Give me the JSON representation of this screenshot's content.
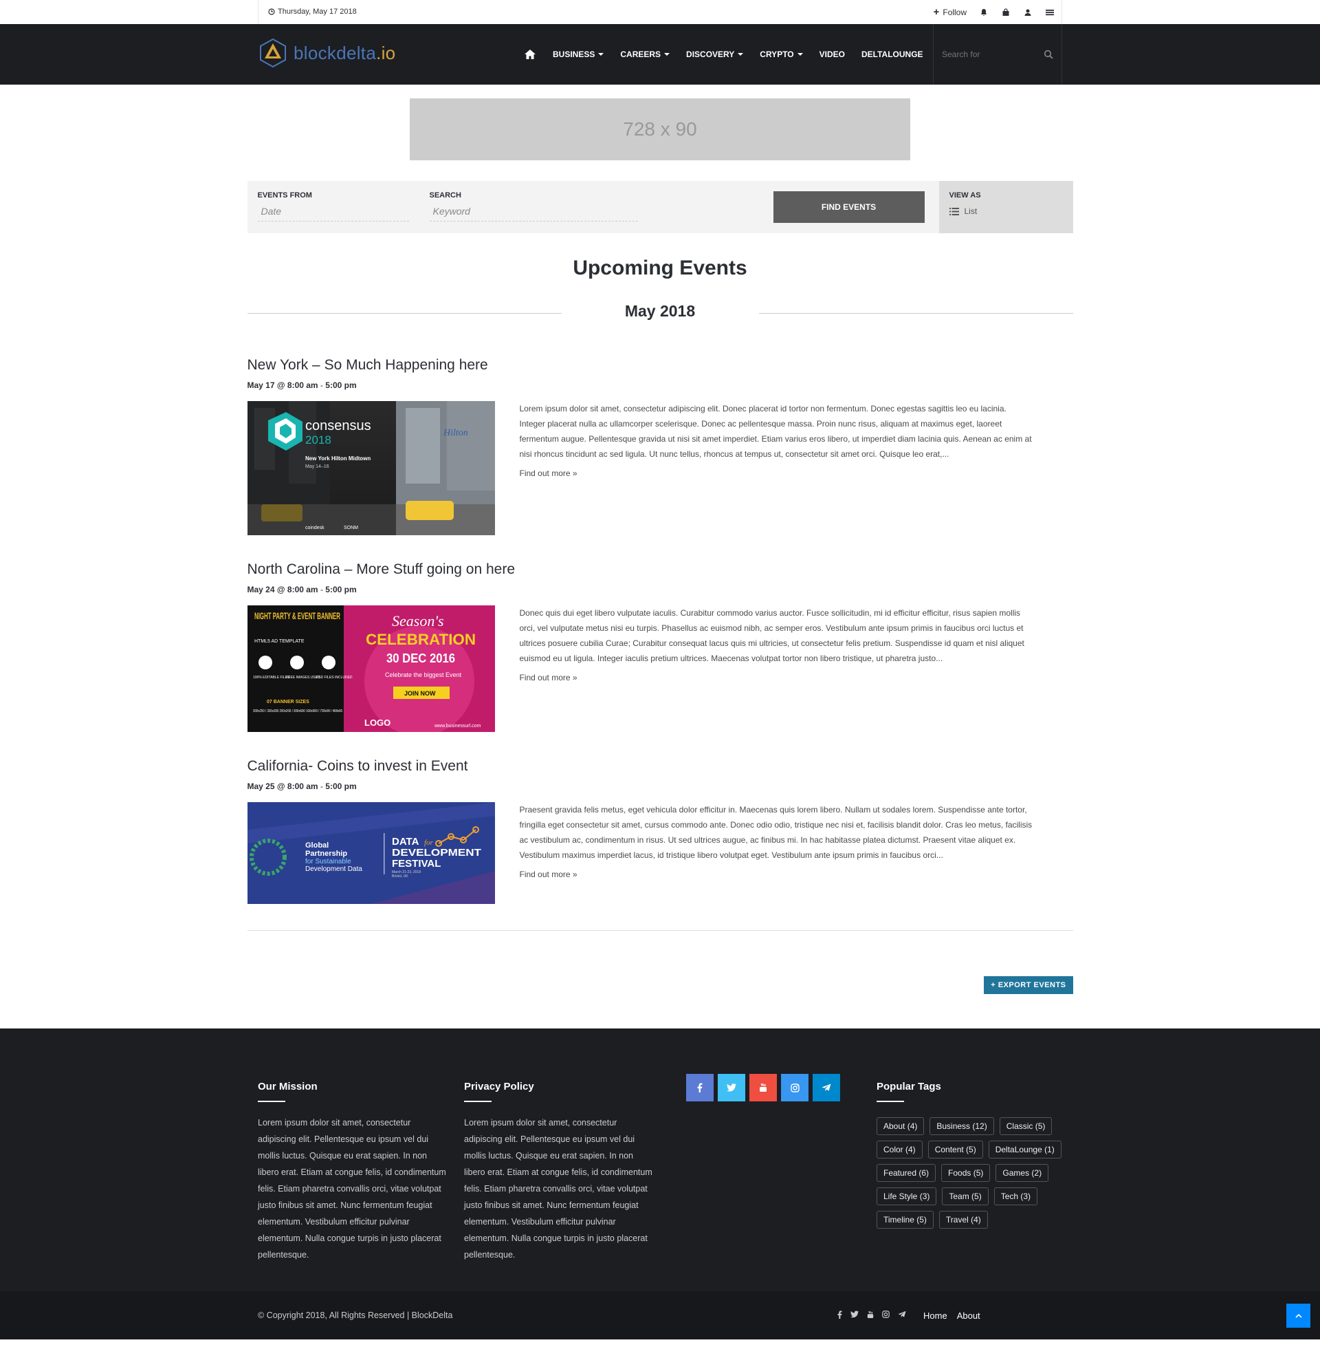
{
  "topbar": {
    "date": "Thursday, May 17 2018",
    "follow": "Follow"
  },
  "logo": {
    "name_main": "blockdelta",
    "name_tld": ".io"
  },
  "nav": {
    "items": [
      {
        "label": "BUSINESS",
        "dropdown": true
      },
      {
        "label": "CAREERS",
        "dropdown": true
      },
      {
        "label": "DISCOVERY",
        "dropdown": true
      },
      {
        "label": "CRYPTO",
        "dropdown": true
      },
      {
        "label": "VIDEO",
        "dropdown": false
      },
      {
        "label": "DELTALOUNGE",
        "dropdown": false
      }
    ],
    "search_placeholder": "Search for"
  },
  "ad": {
    "text": "728 x 90"
  },
  "event_bar": {
    "events_from_label": "EVENTS FROM",
    "events_from_placeholder": "Date",
    "search_label": "SEARCH",
    "search_placeholder": "Keyword",
    "find_button": "FIND EVENTS",
    "view_as_label": "VIEW AS",
    "view_as_value": "List"
  },
  "page_title": "Upcoming Events",
  "month": "May 2018",
  "events": [
    {
      "title": "New York – So Much Happening here",
      "date": "May 17 @ 8:00 am",
      "sep": "-",
      "end": "5:00 pm",
      "description": "Lorem ipsum dolor sit amet, consectetur adipiscing elit. Donec placerat id tortor non fermentum. Donec egestas sagittis leo eu lacinia. Integer placerat nulla ac ullamcorper scelerisque. Donec ac pellentesque massa. Proin nunc risus, aliquam at maximus eget, laoreet fermentum augue. Pellentesque gravida ut nisi sit amet imperdiet. Etiam varius eros libero, ut imperdiet diam lacinia quis. Aenean ac enim at nisi rhoncus tincidunt ac sed ligula. Ut nunc tellus, rhoncus at tempus ut, consectetur sit amet orci. Quisque leo erat,...",
      "more": "Find out more »",
      "image": {
        "brand": "consensus",
        "year": "2018",
        "venue": "New York Hilton Midtown",
        "dates": "May 14–16",
        "sponsor1": "coindesk",
        "sponsor2": "SONM",
        "sign": "Hilton"
      }
    },
    {
      "title": "North Carolina – More Stuff going on here",
      "date": "May 24 @ 8:00 am",
      "sep": "-",
      "end": "5:00 pm",
      "description": "Donec quis dui eget libero vulputate iaculis. Curabitur commodo varius auctor. Fusce sollicitudin, mi id efficitur efficitur, risus sapien mollis orci, vel vulputate metus nisi eu turpis. Phasellus ac euismod nibh, ac semper eros. Vestibulum ante ipsum primis in faucibus orci luctus et ultrices posuere cubilia Curae; Curabitur consequat lacus quis mi ultricies, ut consectetur felis pretium. Suspendisse id quam et nisl aliquet euismod eu ut ligula. Integer iaculis pretium ultrices. Maecenas volutpat tortor non libero tristique, ut pharetra justo...",
      "more": "Find out more »",
      "image": {
        "left_title": "NIGHT PARTY & EVENT BANNER",
        "left_sub": "HTML5 AD TEMPLATE",
        "f1": "100% EDITABLE FILES",
        "f2": "FREE IMAGES USED",
        "f3": "PSD FILES INCLUDED",
        "sizes_title": "07 BANNER SIZES",
        "sizes": "300x250 / 336x280 200x200 / 300x600 160x600 / 728x90 / 468x60",
        "script": "Season's",
        "headline": "CELEBRATION",
        "date": "30 DEC 2016",
        "tagline": "Celebrate the biggest Event",
        "cta": "JOIN NOW",
        "logo": "LOGO",
        "url": "www.businessurl.com"
      }
    },
    {
      "title": "California- Coins to invest in Event",
      "date": "May 25 @ 8:00 am",
      "sep": "-",
      "end": "5:00 pm",
      "description": "Praesent gravida felis metus, eget vehicula dolor efficitur in. Maecenas quis lorem libero. Nullam ut sodales lorem. Suspendisse ante tortor, fringilla eget consectetur sit amet, cursus commodo ante. Donec odio odio, tristique nec nisi et, facilisis blandit dolor. Cras leo metus, facilisis ac vestibulum ac, condimentum in risus. Ut sed ultrices augue, ac finibus mi. In hac habitasse platea dictumst. Praesent vitae aliquet ex. Vestibulum maximus imperdiet lacus, id tristique libero volutpat eget. Vestibulum ante ipsum primis in faucibus orci...",
      "more": "Find out more »",
      "image": {
        "org1": "Global",
        "org2": "Partnership",
        "org3": "for Sustainable",
        "org4": "Development Data",
        "fest1": "DATA",
        "fest_for": "for",
        "fest2": "DEVELOPMENT",
        "fest3": "FESTIVAL",
        "fest_date": "March 21-23, 2018",
        "fest_place": "Bristol, UK"
      }
    }
  ],
  "export_button": "+ EXPORT EVENTS",
  "footer": {
    "mission_title": "Our Mission",
    "mission_text": "Lorem ipsum dolor sit amet, consectetur adipiscing elit. Pellentesque eu ipsum vel dui mollis luctus. Quisque eu erat sapien. In non libero erat. Etiam at congue felis, id condimentum felis. Etiam pharetra convallis orci, vitae volutpat justo finibus sit amet. Nunc fermentum feugiat elementum. Vestibulum efficitur pulvinar elementum. Nulla congue turpis in justo placerat pellentesque.",
    "privacy_title": "Privacy Policy",
    "privacy_text": "Lorem ipsum dolor sit amet, consectetur adipiscing elit. Pellentesque eu ipsum vel dui mollis luctus. Quisque eu erat sapien. In non libero erat. Etiam at congue felis, id condimentum felis. Etiam pharetra convallis orci, vitae volutpat justo finibus sit amet. Nunc fermentum feugiat elementum. Vestibulum efficitur pulvinar elementum. Nulla congue turpis in justo placerat pellentesque.",
    "social": [
      {
        "name": "facebook-icon",
        "color": "#5b7bd5"
      },
      {
        "name": "twitter-icon",
        "color": "#40bff5"
      },
      {
        "name": "youtube-icon",
        "color": "#ef4e41"
      },
      {
        "name": "instagram-icon",
        "color": "#3897f0"
      },
      {
        "name": "telegram-icon",
        "color": "#0088cc"
      }
    ],
    "tags_title": "Popular Tags",
    "tags": [
      "About (4)",
      "Business (12)",
      "Classic (5)",
      "Color (4)",
      "Content (5)",
      "DeltaLounge (1)",
      "Featured (6)",
      "Foods (5)",
      "Games (2)",
      "Life Style (3)",
      "Team (5)",
      "Tech (3)",
      "Timeline (5)",
      "Travel (4)"
    ]
  },
  "bottom": {
    "copyright": "© Copyright 2018, All Rights Reserved  |  BlockDelta",
    "links": [
      "Home",
      "About"
    ]
  }
}
